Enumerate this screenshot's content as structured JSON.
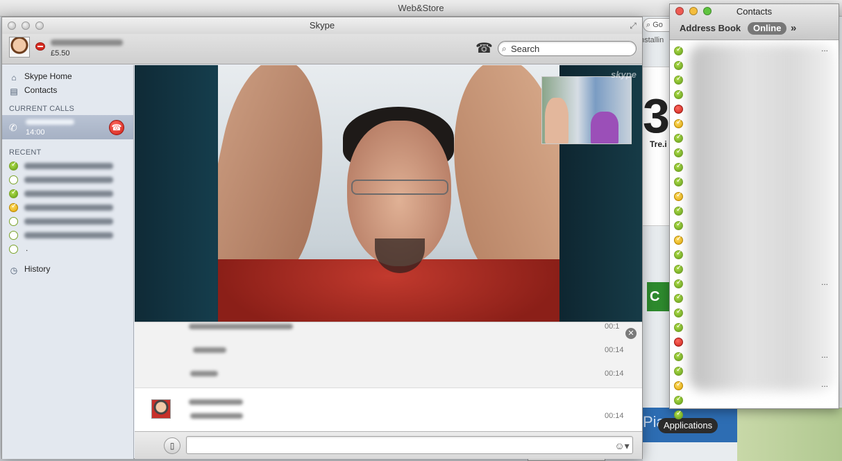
{
  "browser": {
    "window_title": "Web&Store",
    "search_partial": "Go",
    "installing_partial": "nstallin",
    "ad_text": "Tre.i",
    "green_button_partial": "C",
    "blue_banner_partial": "Pia",
    "dock_label": "Applications"
  },
  "skype": {
    "window_title": "Skype",
    "credit": "£5.50",
    "search": {
      "value": "Search",
      "placeholder": "Search"
    },
    "sidebar": {
      "nav": [
        {
          "label": "Skype Home",
          "icon": "home-icon"
        },
        {
          "label": "Contacts",
          "icon": "contacts-book-icon"
        }
      ],
      "current_calls_heading": "CURRENT CALLS",
      "current_call": {
        "time": "14:00"
      },
      "recent_heading": "RECENT",
      "recent": [
        {
          "status": "online"
        },
        {
          "status": "offline"
        },
        {
          "status": "online"
        },
        {
          "status": "away"
        },
        {
          "status": "offline"
        },
        {
          "status": "offline"
        },
        {
          "status": "offline",
          "text": "."
        }
      ],
      "history_label": "History"
    },
    "video": {
      "watermark": "skype"
    },
    "chat": {
      "messages": [
        {
          "time": "00:1"
        },
        {
          "time": "00:14"
        },
        {
          "time": "00:14"
        },
        {
          "time": "00:14"
        }
      ]
    },
    "input": {
      "placeholder": "",
      "emoticon_glyph": "☺▾",
      "sms_glyph": "▯"
    }
  },
  "contacts_window": {
    "title": "Contacts",
    "tab_address_book": "Address Book",
    "tab_online": "Online",
    "more_glyph": "»",
    "rows": [
      "online",
      "online",
      "online",
      "online",
      "dnd",
      "away",
      "online",
      "online",
      "online",
      "online",
      "away",
      "online",
      "online",
      "away",
      "online",
      "online",
      "online",
      "online",
      "online",
      "online",
      "dnd",
      "online",
      "online",
      "away",
      "online",
      "online"
    ],
    "ellipsis": "..."
  },
  "colors": {
    "online": "#5d9c16",
    "away": "#e0a300",
    "dnd": "#cf1f16",
    "selected_call_bg": "#a6b1c4"
  }
}
